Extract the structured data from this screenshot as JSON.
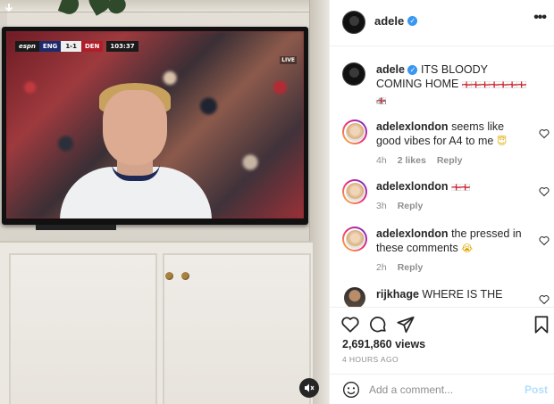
{
  "media": {
    "scorebug": {
      "network": "espn",
      "team1": "ENG",
      "score": "1-1",
      "team2": "DEN",
      "clock": "103:37"
    },
    "live_label": "LIVE",
    "download_icon": "download-arrow-icon",
    "mute_icon": "muted-speaker-icon"
  },
  "header": {
    "username": "adele",
    "verified_icon": "verified-badge-icon",
    "more_icon": "more-options-icon"
  },
  "caption": {
    "username": "adele",
    "text": "ITS BLOODY COMING HOME",
    "flags": "🏴󠁧󠁢󠁥󠁮󠁧󠁿🏴󠁧󠁢󠁥󠁮󠁧󠁿🏴󠁧󠁢󠁥󠁮󠁧󠁿🏴󠁧󠁢󠁥󠁮󠁧󠁿🏴󠁧󠁢󠁥󠁮󠁧󠁿🏴󠁧󠁢󠁥󠁮󠁧󠁿🏴󠁧󠁢󠁥󠁮󠁧󠁿🏴󠁧󠁢󠁥󠁮󠁧󠁿",
    "time": "4h"
  },
  "comments": [
    {
      "username": "adelexlondon",
      "text": "seems like good vibes for A4 to me",
      "emoji": "😇",
      "time": "4h",
      "likes": "2 likes",
      "reply": "Reply"
    },
    {
      "username": "adelexlondon",
      "text": "",
      "emoji": "🏴󠁧󠁢󠁥󠁮󠁧󠁿🏴󠁧󠁢󠁥󠁮󠁧󠁿",
      "time": "3h",
      "likes": "",
      "reply": "Reply"
    },
    {
      "username": "adelexlondon",
      "text": "the pressed in these comments",
      "emoji": "😭",
      "time": "2h",
      "likes": "",
      "reply": "Reply"
    },
    {
      "username": "rijkhage",
      "text": "WHERE IS THE",
      "emoji": "",
      "time": "",
      "likes": "",
      "reply": ""
    }
  ],
  "actions": {
    "like_icon": "heart-icon",
    "comment_icon": "comment-bubble-icon",
    "share_icon": "paper-plane-icon",
    "save_icon": "bookmark-icon",
    "views": "2,691,860 views",
    "posted": "4 HOURS AGO"
  },
  "add_comment": {
    "placeholder": "Add a comment...",
    "post_label": "Post",
    "emoji_icon": "smiley-icon"
  }
}
